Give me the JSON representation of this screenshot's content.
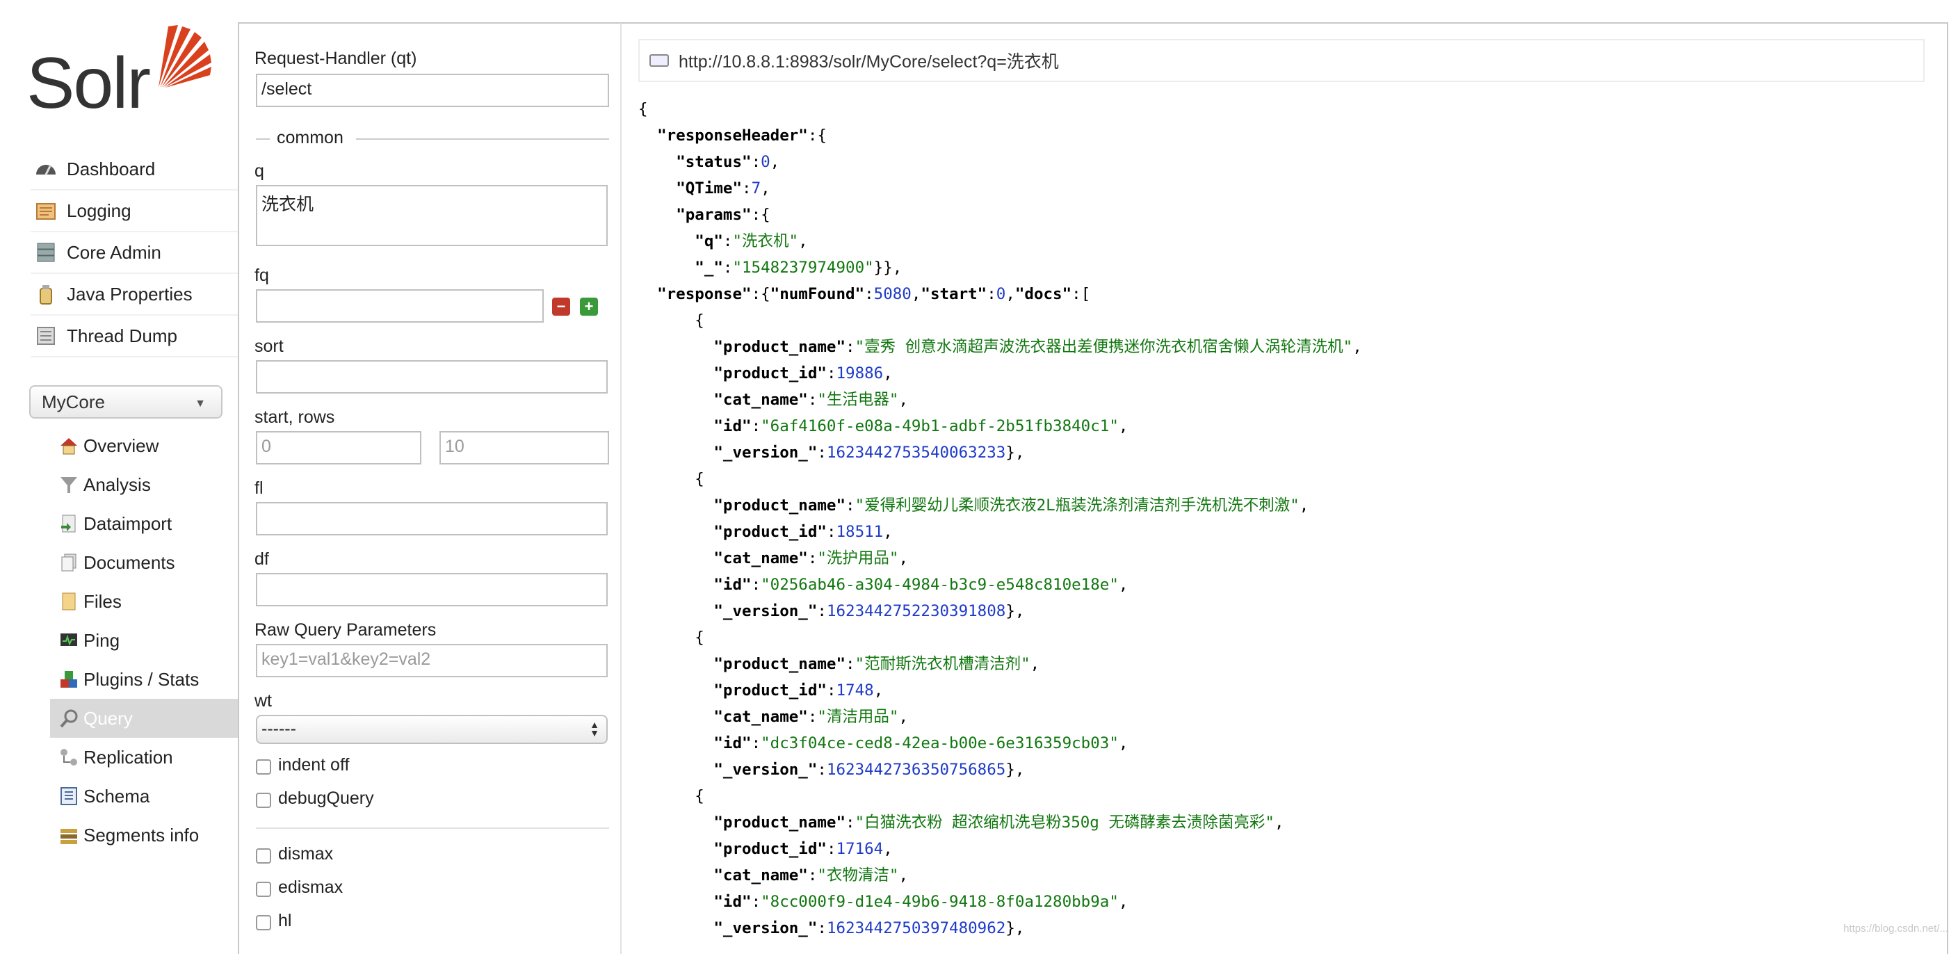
{
  "logo": {
    "text": "Solr"
  },
  "sidebar": {
    "items": [
      {
        "label": "Dashboard",
        "icon": "dashboard-icon"
      },
      {
        "label": "Logging",
        "icon": "logging-icon"
      },
      {
        "label": "Core Admin",
        "icon": "core-admin-icon"
      },
      {
        "label": "Java Properties",
        "icon": "java-properties-icon"
      },
      {
        "label": "Thread Dump",
        "icon": "thread-dump-icon"
      }
    ],
    "core_selector": "MyCore",
    "core_items": [
      {
        "label": "Overview",
        "icon": "home-icon"
      },
      {
        "label": "Analysis",
        "icon": "analysis-funnel-icon"
      },
      {
        "label": "Dataimport",
        "icon": "dataimport-icon"
      },
      {
        "label": "Documents",
        "icon": "documents-icon"
      },
      {
        "label": "Files",
        "icon": "files-icon"
      },
      {
        "label": "Ping",
        "icon": "ping-icon"
      },
      {
        "label": "Plugins / Stats",
        "icon": "plugins-icon"
      },
      {
        "label": "Query",
        "icon": "query-magnifier-icon",
        "active": true
      },
      {
        "label": "Replication",
        "icon": "replication-icon"
      },
      {
        "label": "Schema",
        "icon": "schema-icon"
      },
      {
        "label": "Segments info",
        "icon": "segments-icon"
      }
    ]
  },
  "form": {
    "request_handler_label": "Request-Handler (qt)",
    "request_handler_value": "/select",
    "common_legend": "common",
    "q_label": "q",
    "q_value": "洗衣机",
    "fq_label": "fq",
    "fq_value": "",
    "sort_label": "sort",
    "sort_value": "",
    "start_rows_label": "start, rows",
    "start_placeholder": "0",
    "rows_placeholder": "10",
    "fl_label": "fl",
    "df_label": "df",
    "raw_label": "Raw Query Parameters",
    "raw_placeholder": "key1=val1&key2=val2",
    "wt_label": "wt",
    "wt_value": "------",
    "indent_label": "indent off",
    "debug_label": "debugQuery",
    "dismax_label": "dismax",
    "edismax_label": "edismax",
    "hl_label": "hl"
  },
  "result": {
    "url": "http://10.8.8.1:8983/solr/MyCore/select?q=洗衣机",
    "status": "0",
    "qtime": "7",
    "param_q": "\"洗衣机\"",
    "param_underscore": "\"1548237974900\"",
    "num_found": "5080",
    "start": "0",
    "docs": [
      {
        "product_name": "\"壹秀 创意水滴超声波洗衣器出差便携迷你洗衣机宿舍懒人涡轮清洗机\"",
        "product_id": "19886",
        "cat_name": "\"生活电器\"",
        "id": "\"6af4160f-e08a-49b1-adbf-2b51fb3840c1\"",
        "version": "1623442753540063233"
      },
      {
        "product_name": "\"爱得利婴幼儿柔顺洗衣液2L瓶装洗涤剂清洁剂手洗机洗不刺激\"",
        "product_id": "18511",
        "cat_name": "\"洗护用品\"",
        "id": "\"0256ab46-a304-4984-b3c9-e548c810e18e\"",
        "version": "1623442752230391808"
      },
      {
        "product_name": "\"范耐斯洗衣机槽清洁剂\"",
        "product_id": "1748",
        "cat_name": "\"清洁用品\"",
        "id": "\"dc3f04ce-ced8-42ea-b00e-6e316359cb03\"",
        "version": "1623442736350756865"
      },
      {
        "product_name": "\"白猫洗衣粉 超浓缩机洗皂粉350g 无磷酵素去渍除菌亮彩\"",
        "product_id": "17164",
        "cat_name": "\"衣物清洁\"",
        "id": "\"8cc000f9-d1e4-49b6-9418-8f0a1280bb9a\"",
        "version": "1623442750397480962"
      }
    ]
  },
  "watermark": "https://blog.csdn.net/..."
}
